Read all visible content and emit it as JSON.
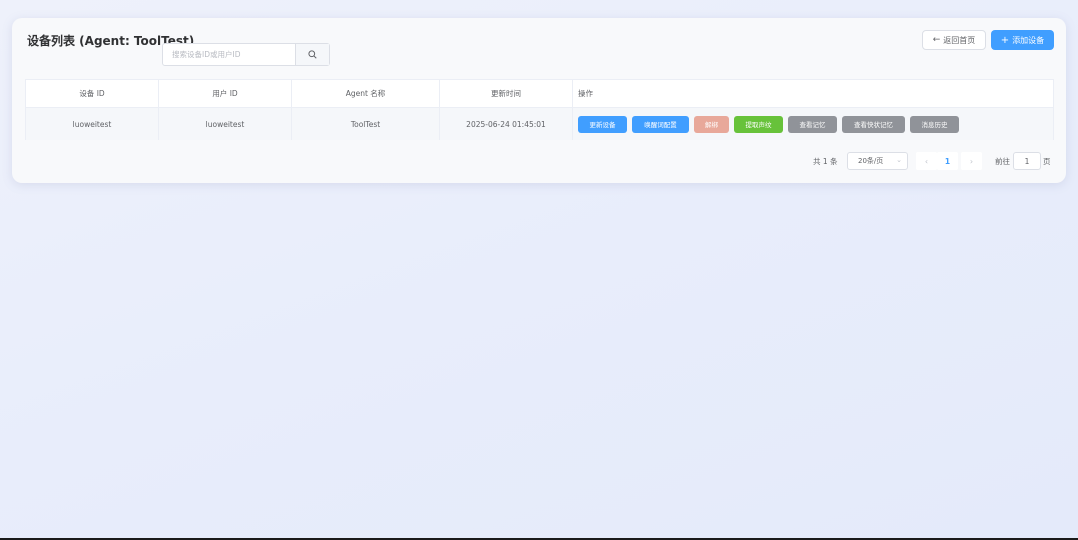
{
  "header": {
    "title": "设备列表 (Agent: ToolTest)",
    "search_placeholder": "搜索设备ID或用户ID",
    "back_label": "返回首页",
    "add_label": "添加设备"
  },
  "table": {
    "columns": [
      "设备 ID",
      "用户 ID",
      "Agent 名称",
      "更新时间",
      "操作"
    ],
    "rows": [
      {
        "device_id": "luoweitest",
        "user_id": "luoweitest",
        "agent_name": "ToolTest",
        "updated_at": "2025-06-24 01:45:01",
        "actions": [
          "更新设备",
          "唤醒词配置",
          "解绑",
          "提取声纹",
          "查看记忆",
          "查看快状记忆",
          "消息历史"
        ]
      }
    ]
  },
  "pagination": {
    "total": "共 1 条",
    "page_size": "20条/页",
    "current_page": "1",
    "goto_prefix": "前往",
    "goto_value": "1",
    "goto_suffix": "页"
  },
  "colors": {
    "primary": "#409eff",
    "danger_muted": "#e8a89a",
    "success": "#67c23a",
    "info": "#909399"
  }
}
